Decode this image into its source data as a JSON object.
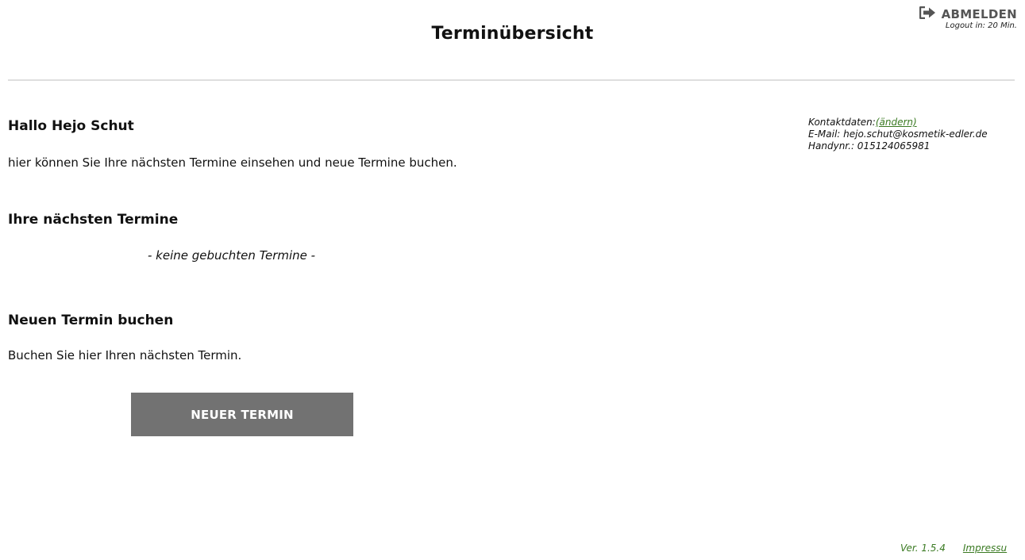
{
  "header": {
    "title": "Terminübersicht",
    "logout_label": "ABMELDEN",
    "logout_timer": "Logout in: 20 Min."
  },
  "greeting": {
    "title": "Hallo Hejo Schut",
    "text": "hier können Sie Ihre nächsten Termine einsehen und neue Termine buchen."
  },
  "contact": {
    "label": "Kontaktdaten:",
    "change_link": "(ändern)",
    "email": "E-Mail: hejo.schut@kosmetik-edler.de",
    "phone": "Handynr.: 015124065981"
  },
  "appointments": {
    "heading": "Ihre nächsten Termine",
    "empty_text": "- keine gebuchten Termine -"
  },
  "booking": {
    "heading": "Neuen Termin buchen",
    "text": "Buchen Sie hier Ihren nächsten Termin.",
    "button_label": "NEUER TERMIN"
  },
  "footer": {
    "version": "Ver. 1.5.4",
    "impressum": "Impressu"
  },
  "colors": {
    "link_green": "#3a7a22",
    "button_gray": "#727272",
    "divider": "#dedede"
  },
  "icons": {
    "logout": "sign-out-icon"
  }
}
